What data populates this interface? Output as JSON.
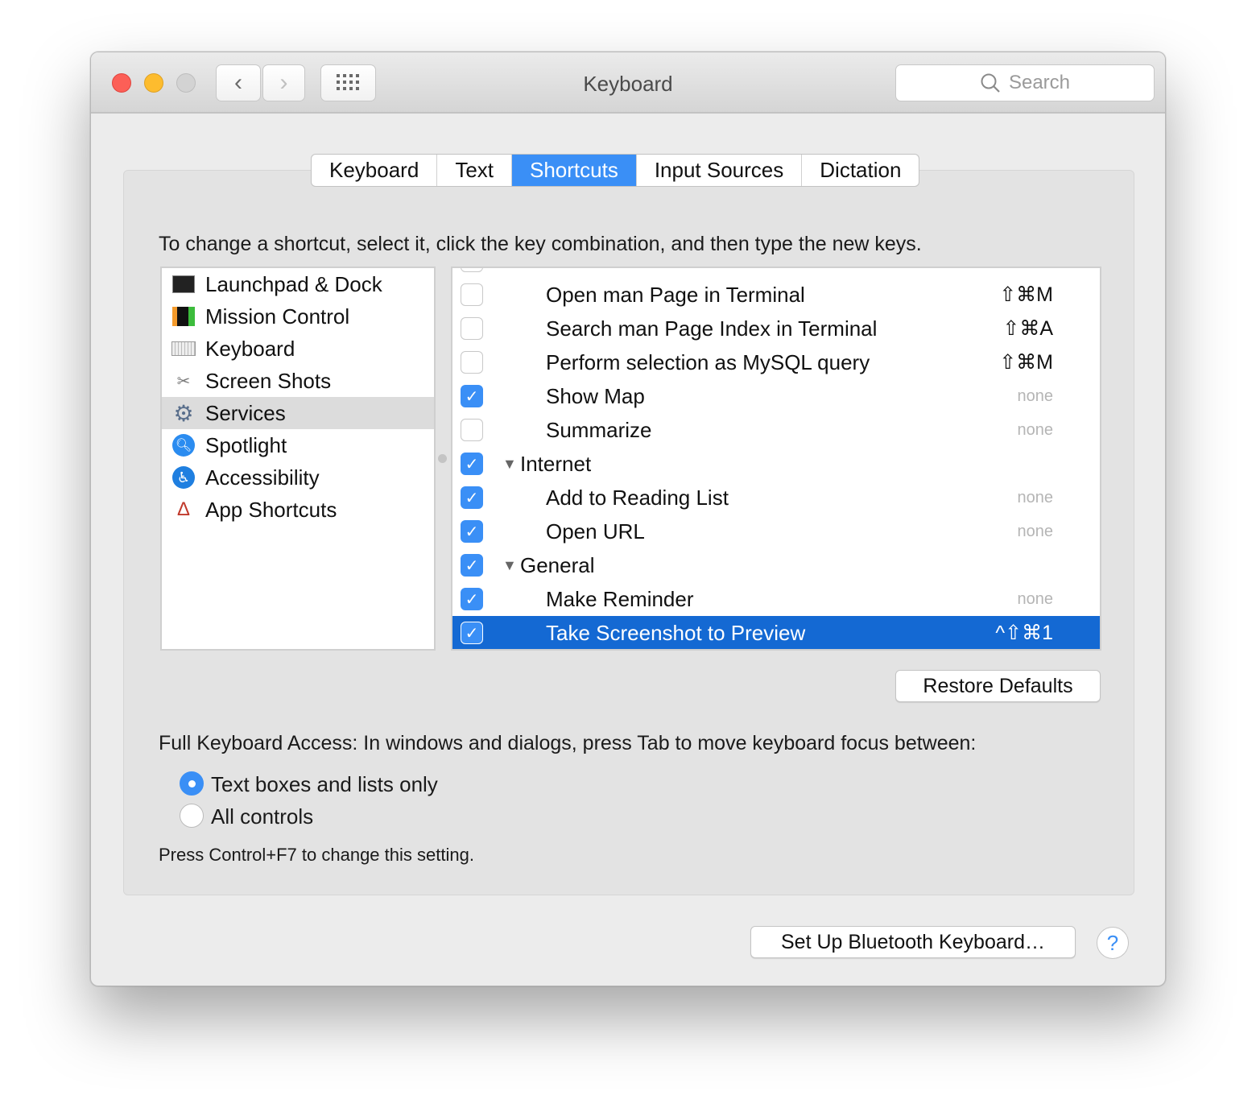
{
  "window": {
    "title": "Keyboard",
    "search_placeholder": "Search"
  },
  "tabs": [
    "Keyboard",
    "Text",
    "Shortcuts",
    "Input Sources",
    "Dictation"
  ],
  "instructions": "To change a shortcut, select it, click the key combination, and then type the new keys.",
  "categories": [
    {
      "label": "Launchpad & Dock",
      "icon": "launchpad-icon"
    },
    {
      "label": "Mission Control",
      "icon": "mission-control-icon"
    },
    {
      "label": "Keyboard",
      "icon": "keyboard-icon"
    },
    {
      "label": "Screen Shots",
      "icon": "screenshot-icon"
    },
    {
      "label": "Services",
      "icon": "gear-icon",
      "selected": true
    },
    {
      "label": "Spotlight",
      "icon": "spotlight-icon"
    },
    {
      "label": "Accessibility",
      "icon": "accessibility-icon"
    },
    {
      "label": "App Shortcuts",
      "icon": "app-shortcuts-icon"
    }
  ],
  "shortcuts": [
    {
      "label": "Open man Page in Terminal",
      "checked": false,
      "shortcut": "⇧⌘M"
    },
    {
      "label": "Search man Page Index in Terminal",
      "checked": false,
      "shortcut": "⇧⌘A"
    },
    {
      "label": "Perform selection as MySQL query",
      "checked": false,
      "shortcut": "⇧⌘M"
    },
    {
      "label": "Show Map",
      "checked": true,
      "shortcut": "none"
    },
    {
      "label": "Summarize",
      "checked": false,
      "shortcut": "none"
    },
    {
      "label": "Internet",
      "checked": true,
      "group": true,
      "shortcut": ""
    },
    {
      "label": "Add to Reading List",
      "checked": true,
      "shortcut": "none"
    },
    {
      "label": "Open URL",
      "checked": true,
      "shortcut": "none"
    },
    {
      "label": "General",
      "checked": true,
      "group": true,
      "shortcut": ""
    },
    {
      "label": "Make Reminder",
      "checked": true,
      "shortcut": "none"
    },
    {
      "label": "Take Screenshot to Preview",
      "checked": true,
      "shortcut": "^⇧⌘1",
      "selected": true
    }
  ],
  "restore_defaults": "Restore Defaults",
  "full_access": {
    "label": "Full Keyboard Access: In windows and dialogs, press Tab to move keyboard focus between:",
    "options": [
      {
        "label": "Text boxes and lists only",
        "selected": true
      },
      {
        "label": "All controls",
        "selected": false
      }
    ],
    "hint": "Press Control+F7 to change this setting."
  },
  "bluetooth_button": "Set Up Bluetooth Keyboard…",
  "help": "?"
}
